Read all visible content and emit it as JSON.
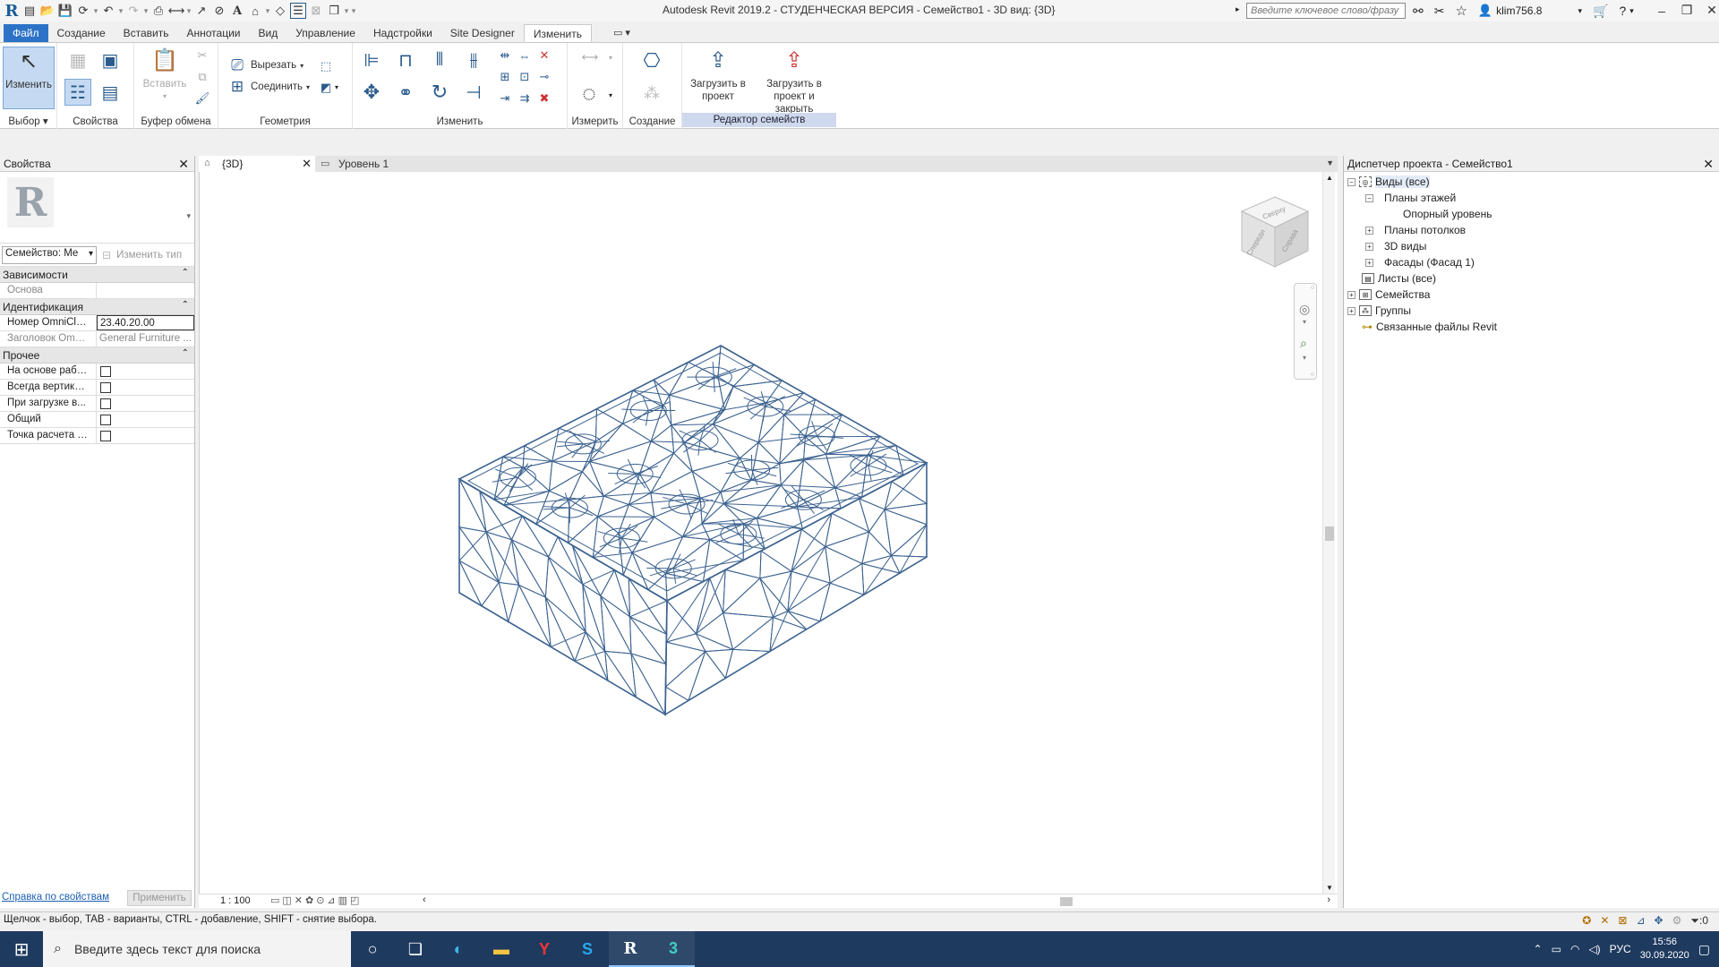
{
  "titlebar": {
    "title": "Autodesk Revit 2019.2 - СТУДЕНЧЕСКАЯ ВЕРСИЯ - Семейство1 - 3D вид: {3D}",
    "search_placeholder": "Введите ключевое слово/фразу",
    "user": "klim756.8"
  },
  "ribbon_tabs": [
    "Файл",
    "Создание",
    "Вставить",
    "Аннотации",
    "Вид",
    "Управление",
    "Надстройки",
    "Site Designer",
    "Изменить"
  ],
  "ribbon": {
    "modify_label": "Изменить",
    "select_label": "Выбор",
    "props_label": "Свойства",
    "paste_label": "Вставить",
    "clipboard_label": "Буфер обмена",
    "cut_label": "Вырезать",
    "join_label": "Соединить",
    "geometry_label": "Геометрия",
    "modify_group_label": "Изменить",
    "measure_label": "Измерить",
    "create_label": "Создание",
    "load_into_project": "Загрузить в проект",
    "load_into_project_close": "Загрузить в проект и закрыть",
    "family_editor_label": "Редактор семейств"
  },
  "properties": {
    "title": "Свойства",
    "family_select": "Семейство: Ме",
    "edit_type": "Изменить тип",
    "cat_constraints": "Зависимости",
    "base_label": "Основа",
    "cat_identity": "Идентификация",
    "omniclass_number_label": "Номер OmniClass",
    "omniclass_number_value": "23.40.20.00",
    "omniclass_title_label": "Заголовок Omn...",
    "omniclass_title_value": "General Furniture ...",
    "cat_other": "Прочее",
    "other_rows": [
      "На основе рабо...",
      "Всегда вертикал...",
      "При загрузке в...",
      "Общий",
      "Точка расчета п..."
    ],
    "help_link": "Справка по свойствам",
    "apply": "Применить"
  },
  "view_tabs": [
    {
      "label": "{3D}"
    },
    {
      "label": "Уровень 1"
    }
  ],
  "viewcube": {
    "top": "Сверху",
    "front": "Спереди",
    "right": "Справа"
  },
  "view_control": {
    "scale": "1 : 100"
  },
  "browser": {
    "title": "Диспетчер проекта - Семейство1",
    "nodes": [
      "Виды (все)",
      "Планы этажей",
      "Опорный уровень",
      "Планы потолков",
      "3D виды",
      "Фасады (Фасад 1)",
      "Листы (все)",
      "Семейства",
      "Группы",
      "Связанные файлы Revit"
    ]
  },
  "statusbar": {
    "hint": "Щелчок - выбор, TAB - варианты, CTRL - добавление, SHIFT - снятие выбора.",
    "filter_count": ":0"
  },
  "taskbar": {
    "search_placeholder": "Введите здесь текст для поиска",
    "lang": "РУС",
    "time": "15:56",
    "date": "30.09.2020"
  },
  "colors": {
    "file_tab": "#2c73c8",
    "taskbar": "#1e3a5f",
    "model_stroke": "#3d6390",
    "family_editor": "#cfd9ee"
  }
}
